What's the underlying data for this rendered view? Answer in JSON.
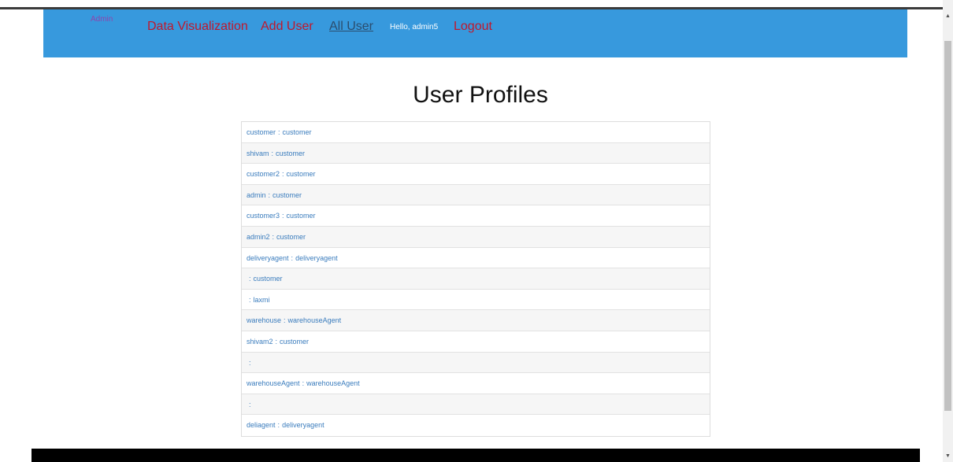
{
  "nav": {
    "brand": "Admin",
    "links": [
      {
        "label": "Data Visualization"
      },
      {
        "label": "Add User"
      },
      {
        "label": "All User"
      }
    ],
    "greeting": "Hello, admin5",
    "logout": "Logout"
  },
  "page": {
    "title": "User Profiles"
  },
  "profiles": [
    {
      "username": "customer",
      "role": "customer"
    },
    {
      "username": "shivam",
      "role": "customer"
    },
    {
      "username": "customer2",
      "role": "customer"
    },
    {
      "username": "admin",
      "role": "customer"
    },
    {
      "username": "customer3",
      "role": "customer"
    },
    {
      "username": "admin2",
      "role": "customer"
    },
    {
      "username": "deliveryagent",
      "role": "deliveryagent"
    },
    {
      "username": "",
      "role": "customer"
    },
    {
      "username": "",
      "role": "laxmi"
    },
    {
      "username": "warehouse",
      "role": "warehouseAgent"
    },
    {
      "username": "shivam2",
      "role": "customer"
    },
    {
      "username": "",
      "role": ""
    },
    {
      "username": "warehouseAgent",
      "role": "warehouseAgent"
    },
    {
      "username": "",
      "role": ""
    },
    {
      "username": "deliagent",
      "role": "deliveryagent"
    }
  ],
  "separator": ":",
  "colors": {
    "navbar": "#3799dd",
    "nav_link": "#c0182d",
    "brand": "#8e44ad",
    "profile_text": "#3a7cbd",
    "footer": "#000000"
  },
  "icons": {
    "scroll_up": "scroll-up-arrow-icon",
    "scroll_down": "scroll-down-arrow-icon"
  }
}
